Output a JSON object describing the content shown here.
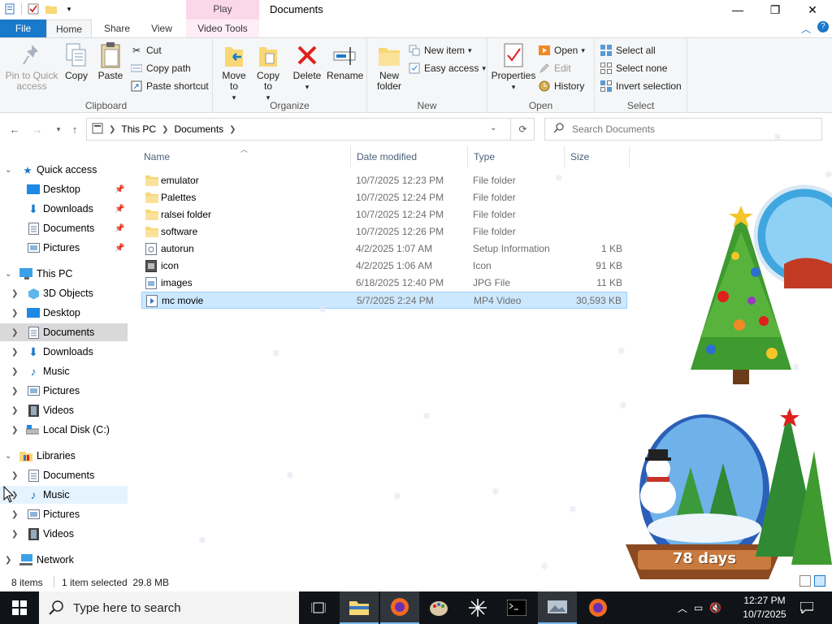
{
  "titlebar": {
    "context_tab": "Play",
    "window_title": "Documents",
    "minimize": "—",
    "maximize": "❐",
    "close": "✕"
  },
  "tabs": {
    "file": "File",
    "home": "Home",
    "share": "Share",
    "view": "View",
    "video_tools": "Video Tools"
  },
  "ribbon": {
    "clipboard": {
      "label": "Clipboard",
      "pin": "Pin to Quick access",
      "copy": "Copy",
      "paste": "Paste",
      "cut": "Cut",
      "copy_path": "Copy path",
      "paste_shortcut": "Paste shortcut"
    },
    "organize": {
      "label": "Organize",
      "move_to": "Move to",
      "copy_to": "Copy to",
      "delete": "Delete",
      "rename": "Rename"
    },
    "new": {
      "label": "New",
      "new_folder": "New folder",
      "new_item": "New item",
      "easy_access": "Easy access"
    },
    "open": {
      "label": "Open",
      "properties": "Properties",
      "open": "Open",
      "edit": "Edit",
      "history": "History"
    },
    "select": {
      "label": "Select",
      "select_all": "Select all",
      "select_none": "Select none",
      "invert": "Invert selection"
    }
  },
  "address": {
    "crumbs": [
      "This PC",
      "Documents"
    ],
    "search_placeholder": "Search Documents"
  },
  "navpane": {
    "quick_access": "Quick access",
    "quick_items": [
      "Desktop",
      "Downloads",
      "Documents",
      "Pictures"
    ],
    "this_pc": "This PC",
    "pc_items": [
      "3D Objects",
      "Desktop",
      "Documents",
      "Downloads",
      "Music",
      "Pictures",
      "Videos",
      "Local Disk (C:)"
    ],
    "libraries": "Libraries",
    "lib_items": [
      "Documents",
      "Music",
      "Pictures",
      "Videos"
    ],
    "network": "Network"
  },
  "columns": {
    "name": "Name",
    "date": "Date modified",
    "type": "Type",
    "size": "Size"
  },
  "files": [
    {
      "name": "emulator",
      "date": "10/7/2025 12:23 PM",
      "type": "File folder",
      "size": ""
    },
    {
      "name": "Palettes",
      "date": "10/7/2025 12:24 PM",
      "type": "File folder",
      "size": ""
    },
    {
      "name": "ralsei folder",
      "date": "10/7/2025 12:24 PM",
      "type": "File folder",
      "size": ""
    },
    {
      "name": "software",
      "date": "10/7/2025 12:26 PM",
      "type": "File folder",
      "size": ""
    },
    {
      "name": "autorun",
      "date": "4/2/2025 1:07 AM",
      "type": "Setup Information",
      "size": "1 KB"
    },
    {
      "name": "icon",
      "date": "4/2/2025 1:06 AM",
      "type": "Icon",
      "size": "91 KB"
    },
    {
      "name": "images",
      "date": "6/18/2025 12:40 PM",
      "type": "JPG File",
      "size": "11 KB"
    },
    {
      "name": "mc movie",
      "date": "5/7/2025 2:24 PM",
      "type": "MP4 Video",
      "size": "30,593 KB"
    }
  ],
  "status": {
    "item_count": "8 items",
    "selection": "1 item selected  29.8 MB"
  },
  "desktop": {
    "countdown": "78 days",
    "countdown_partial": "days"
  },
  "taskbar": {
    "search_placeholder": "Type here to search",
    "time": "12:27 PM",
    "date": "10/7/2025"
  },
  "colors": {
    "file_tab": "#1979ca",
    "selection": "#cce8ff",
    "folder": "#f8d775",
    "taskbar": "#101418"
  }
}
